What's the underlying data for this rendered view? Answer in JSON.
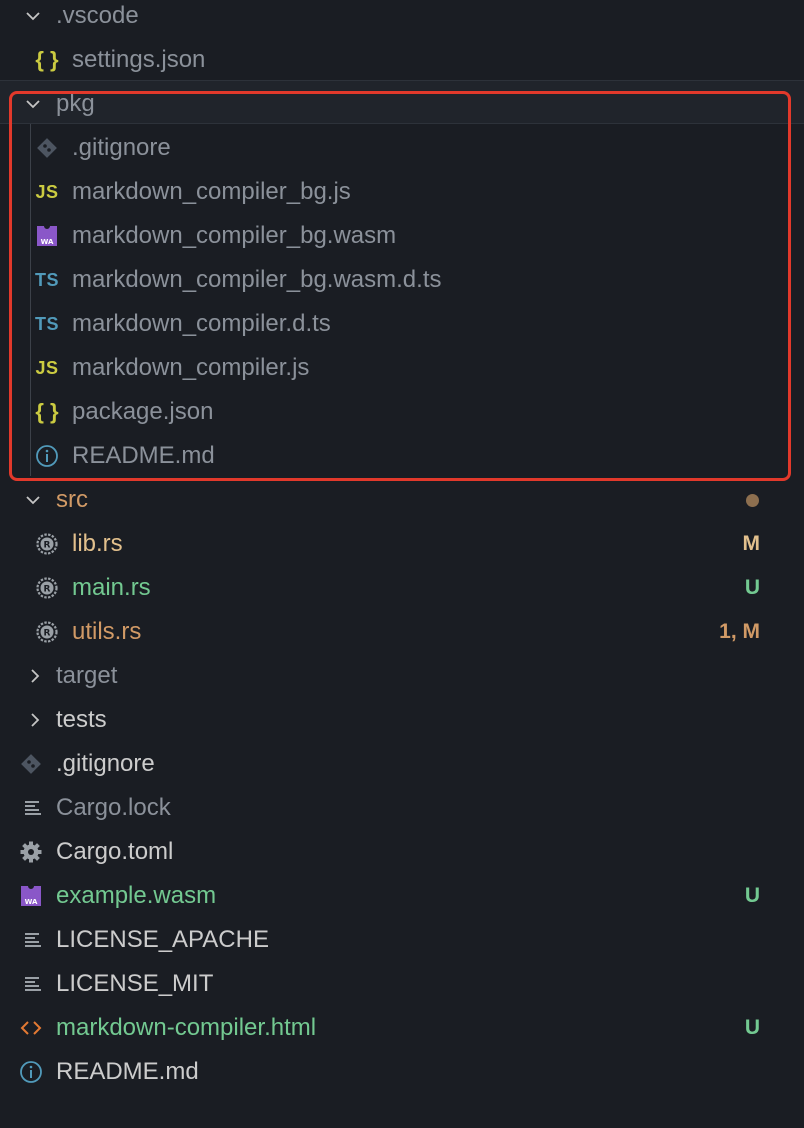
{
  "explorer": {
    "vscode": {
      "name": ".vscode",
      "children": [
        {
          "name": "settings.json",
          "icon": "json-braces-icon"
        }
      ]
    },
    "pkg": {
      "name": "pkg",
      "children": [
        {
          "name": ".gitignore",
          "icon": "git-diamond-icon"
        },
        {
          "name": "markdown_compiler_bg.js",
          "icon": "js-icon",
          "icon_text": "JS"
        },
        {
          "name": "markdown_compiler_bg.wasm",
          "icon": "wasm-icon",
          "icon_text": "WA"
        },
        {
          "name": "markdown_compiler_bg.wasm.d.ts",
          "icon": "ts-icon",
          "icon_text": "TS"
        },
        {
          "name": "markdown_compiler.d.ts",
          "icon": "ts-icon",
          "icon_text": "TS"
        },
        {
          "name": "markdown_compiler.js",
          "icon": "js-icon",
          "icon_text": "JS"
        },
        {
          "name": "package.json",
          "icon": "json-braces-icon"
        },
        {
          "name": "README.md",
          "icon": "info-icon"
        }
      ]
    },
    "src": {
      "name": "src",
      "children": [
        {
          "name": "lib.rs",
          "icon": "rust-icon",
          "decoration": "M"
        },
        {
          "name": "main.rs",
          "icon": "rust-icon",
          "decoration": "U"
        },
        {
          "name": "utils.rs",
          "icon": "rust-icon",
          "decoration": "1, M"
        }
      ]
    },
    "folders": [
      {
        "name": "target"
      },
      {
        "name": "tests"
      }
    ],
    "root_files": [
      {
        "name": ".gitignore",
        "icon": "git-diamond-icon"
      },
      {
        "name": "Cargo.lock",
        "icon": "lines-icon"
      },
      {
        "name": "Cargo.toml",
        "icon": "gear-icon"
      },
      {
        "name": "example.wasm",
        "icon": "wasm-icon",
        "icon_text": "WA",
        "decoration": "U"
      },
      {
        "name": "LICENSE_APACHE",
        "icon": "lines-icon"
      },
      {
        "name": "LICENSE_MIT",
        "icon": "lines-icon"
      },
      {
        "name": "markdown-compiler.html",
        "icon": "html-icon",
        "decoration": "U"
      },
      {
        "name": "README.md",
        "icon": "info-icon"
      }
    ]
  },
  "colors": {
    "default_text": "#cccccc",
    "ignored_text": "#8b919a",
    "modified": "#e2c08d",
    "untracked": "#73c991",
    "warning_modified": "#d19a66",
    "highlight_border": "#e2392b"
  },
  "glyphs": {
    "braces": "{ }",
    "chevron_down": "v",
    "chevron_right": ">"
  }
}
